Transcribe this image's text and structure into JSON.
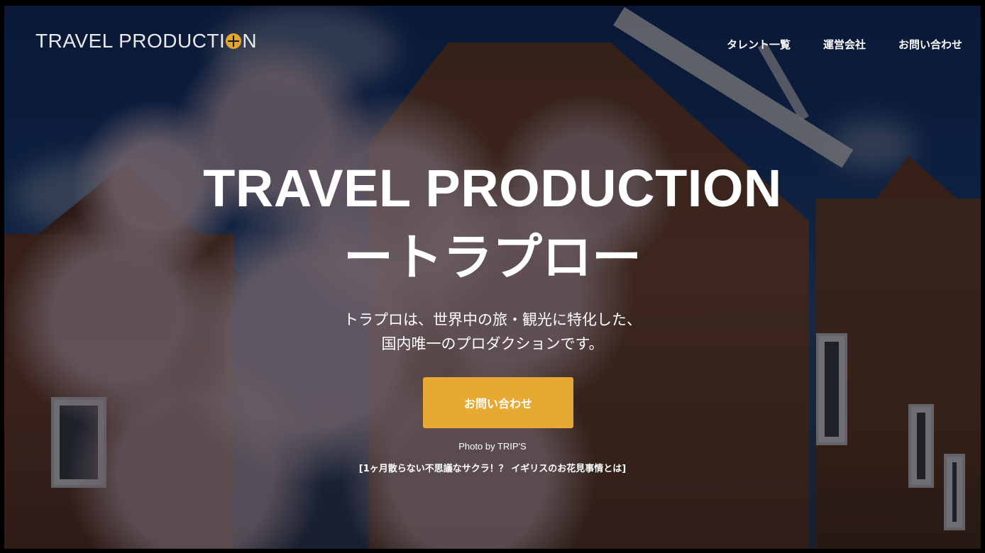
{
  "brand": {
    "logo_text_left": "TRAVEL PRODUCTI",
    "logo_text_right": "N"
  },
  "nav": [
    {
      "label": "タレント一覧"
    },
    {
      "label": "運営会社"
    },
    {
      "label": "お問い合わせ"
    }
  ],
  "hero": {
    "title": "TRAVEL PRODUCTION",
    "subtitle": "ートラプロー",
    "tagline_line1": "トラプロは、世界中の旅・観光に特化した、",
    "tagline_line2": "国内唯一のプロダクションです。",
    "cta_label": "お問い合わせ",
    "credit_line1": "Photo by TRIP'S",
    "credit_line2": "[1ヶ月散らない不思議なサクラ！？ イギリスのお花見事情とは]"
  },
  "colors": {
    "accent": "#e8a934",
    "overlay": "rgba(10,10,15,0.55)"
  }
}
